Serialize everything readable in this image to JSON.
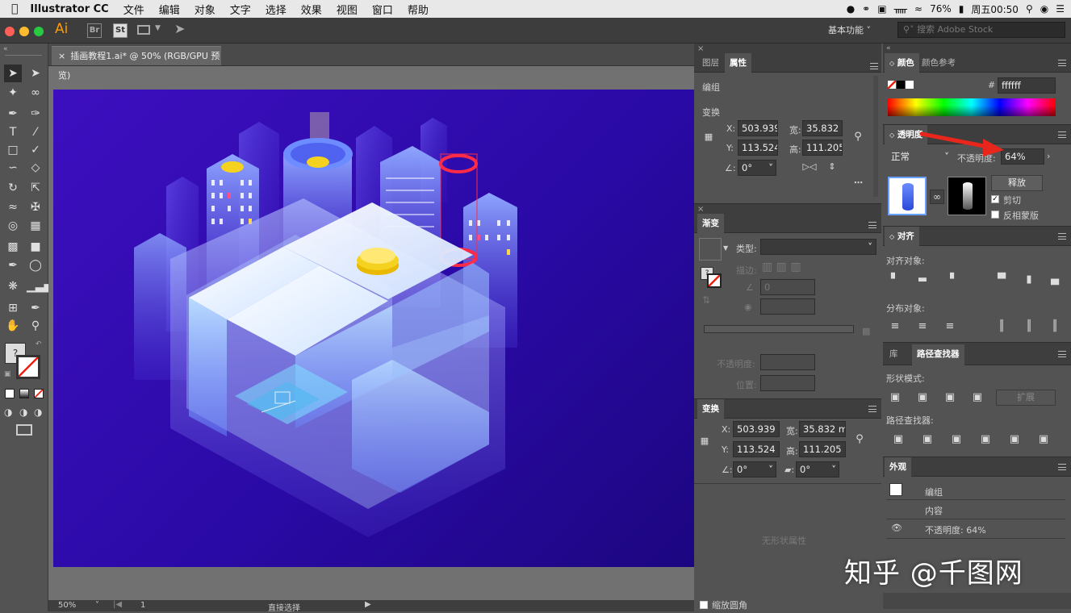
{
  "menubar": {
    "app": "Illustrator CC",
    "items": [
      "文件",
      "编辑",
      "对象",
      "文字",
      "选择",
      "效果",
      "视图",
      "窗口",
      "帮助"
    ],
    "battery": "76%",
    "clock": "周五00:50"
  },
  "appbar": {
    "badges": [
      "Ai",
      "Br",
      "St"
    ],
    "workspace": "基本功能",
    "stock_placeholder": "搜索 Adobe Stock"
  },
  "document": {
    "tab_title": "插画教程1.ai* @ 50% (RGB/GPU 预览)",
    "zoom": "50%",
    "page": "1",
    "status_tool": "直接选择"
  },
  "properties": {
    "tabs": [
      "图层",
      "属性"
    ],
    "selection_type": "编组",
    "transform_label": "变换",
    "x_label": "X:",
    "x": "503.939",
    "y_label": "Y:",
    "y": "113.524",
    "w_label": "宽:",
    "w": "35.832 r",
    "h_label": "高:",
    "h": "111.205",
    "angle": "0°"
  },
  "gradient": {
    "title": "渐变",
    "type_label": "类型:",
    "stroke_label": "描边:",
    "angle": "0",
    "opacity_label": "不透明度:",
    "position_label": "位置:"
  },
  "transform": {
    "title": "变换",
    "x_label": "X:",
    "x": "503.939 n",
    "y_label": "Y:",
    "y": "113.524 n",
    "w_label": "宽:",
    "w": "35.832 m",
    "h_label": "高:",
    "h": "111.205",
    "angle": "0°",
    "shear": "0°",
    "no_shape": "无形状属性",
    "scale_corners": "缩放圆角"
  },
  "color": {
    "tabs": [
      "颜色",
      "颜色参考"
    ],
    "hash": "#",
    "hex": "ffffff"
  },
  "transparency": {
    "title": "透明度",
    "blend_mode": "正常",
    "opacity_label": "不透明度:",
    "opacity": "64%",
    "release": "释放",
    "clip": "剪切",
    "invert": "反相蒙版",
    "accent": "#e8261b"
  },
  "align": {
    "title": "对齐",
    "align_objects": "对齐对象:",
    "distribute_objects": "分布对象:"
  },
  "pathfinder": {
    "tabs": [
      "库",
      "路径查找器"
    ],
    "shape_modes": "形状模式:",
    "expand": "扩展",
    "pathfinders": "路径查找器:"
  },
  "appearance": {
    "title": "外观",
    "rows": [
      "编组",
      "内容",
      "不透明度: 64%"
    ]
  },
  "watermark": "知乎 @千图网",
  "artwork": {
    "bg_top": "#3d0fbf",
    "bg_bottom": "#1c0680",
    "coin": "#f5d21f"
  }
}
